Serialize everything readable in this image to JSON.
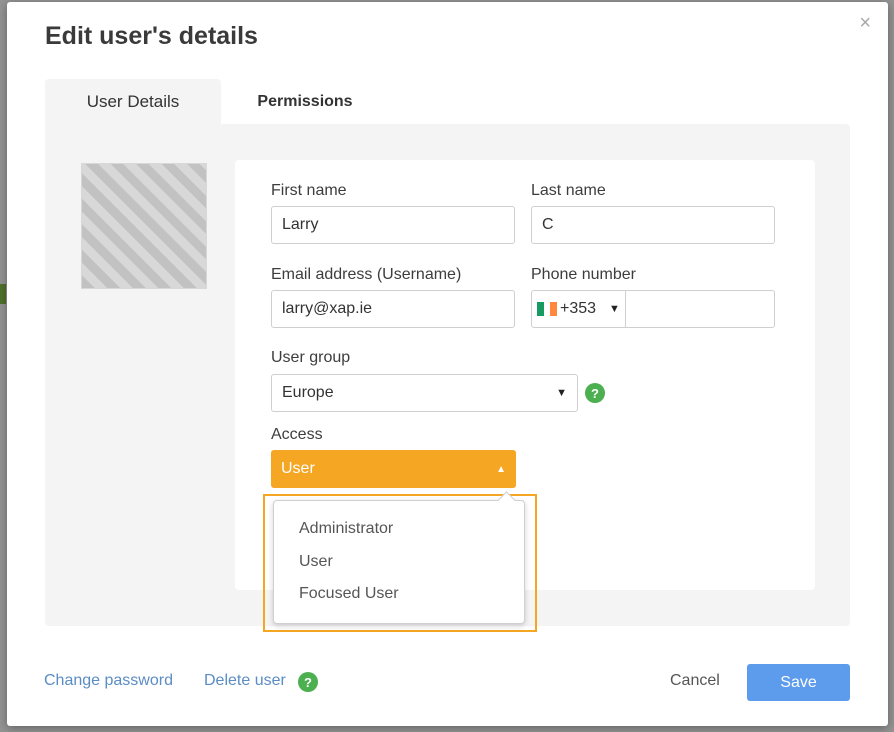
{
  "modal": {
    "title": "Edit user's details",
    "close_symbol": "×"
  },
  "tabs": [
    {
      "label": "User Details",
      "active": true
    },
    {
      "label": "Permissions",
      "active": false
    }
  ],
  "form": {
    "first_name": {
      "label": "First name",
      "value": "Larry"
    },
    "last_name": {
      "label": "Last name",
      "value": "C"
    },
    "email": {
      "label": "Email address (Username)",
      "value": "larry@xap.ie"
    },
    "phone": {
      "label": "Phone number",
      "country_code": "+353",
      "flag": "ireland-flag-icon",
      "value": ""
    },
    "user_group": {
      "label": "User group",
      "value": "Europe"
    },
    "access": {
      "label": "Access",
      "value": "User",
      "options": [
        "Administrator",
        "User",
        "Focused User"
      ]
    },
    "help_symbol": "?"
  },
  "footer": {
    "change_password": "Change password",
    "delete_user": "Delete user",
    "cancel": "Cancel",
    "save": "Save"
  },
  "colors": {
    "accent_orange": "#f5a623",
    "save_blue": "#5d9cec",
    "help_green": "#4caf50",
    "link_blue": "#5b8cc4"
  }
}
